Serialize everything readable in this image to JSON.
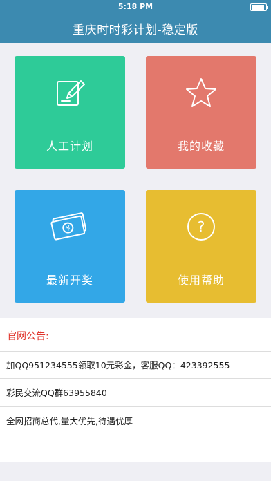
{
  "status_bar": {
    "time": "5:18 PM"
  },
  "header": {
    "title": "重庆时时彩计划-稳定版"
  },
  "tiles": [
    {
      "label": "人工计划",
      "icon": "edit-icon",
      "color": "#2ecb98"
    },
    {
      "label": "我的收藏",
      "icon": "star-icon",
      "color": "#e3786c"
    },
    {
      "label": "最新开奖",
      "icon": "money-icon",
      "color": "#33a7e7"
    },
    {
      "label": "使用帮助",
      "icon": "help-icon",
      "color": "#e7bd31"
    }
  ],
  "announcements": {
    "title": "官网公告:",
    "items": [
      "加QQ951234555领取10元彩金，客服QQ：423392555",
      "彩民交流QQ群63955840",
      "全网招商总代,量大优先,待遇优厚"
    ]
  }
}
